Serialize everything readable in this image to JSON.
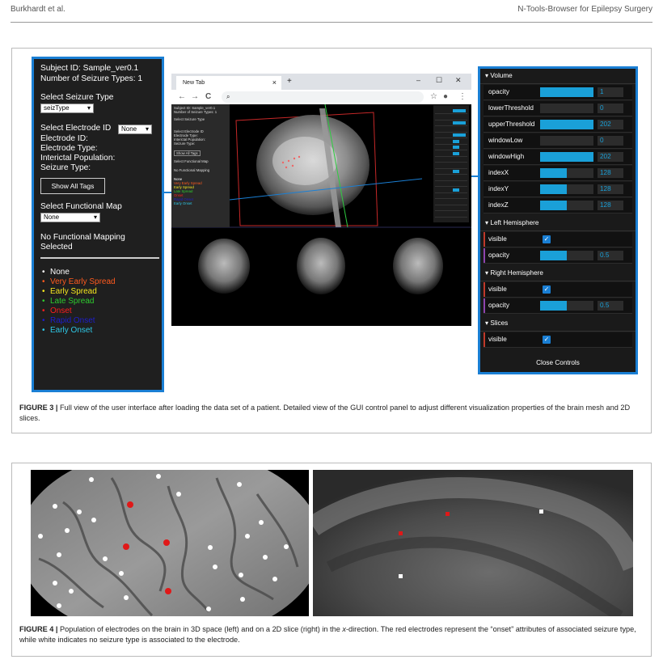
{
  "header": {
    "left": "Burkhardt et al.",
    "right": "N-Tools-Browser for Epilepsy Surgery"
  },
  "figure3": {
    "caption_label": "FIGURE 3 |",
    "caption_text": " Full view of the user interface after loading the data set of a patient. Detailed view of the GUI control panel to adjust different visualization properties of the brain mesh and 2D slices.",
    "left_panel": {
      "subject_id": "Subject ID: Sample_ver0.1",
      "seizure_types": "Number of Seizure Types: 1",
      "select_seizure_label": "Select Seizure Type",
      "seizure_select_value": "seizType",
      "select_electrode_label": "Select Electrode ID",
      "electrode_select_value": "None",
      "electrode_id": "Electrode ID:",
      "electrode_type": "Electrode Type:",
      "interictal": "Interictal Population:",
      "seizure_type": "Seizure Type:",
      "show_all_tags": "Show All Tags",
      "select_functional_label": "Select Functional Map",
      "functional_select_value": "None",
      "no_mapping_1": "No Functional Mapping",
      "no_mapping_2": "Selected",
      "legend": [
        {
          "label": "None",
          "color": "#ffffff"
        },
        {
          "label": "Very Early Spread",
          "color": "#ff5a1e"
        },
        {
          "label": "Early Spread",
          "color": "#f5e61e"
        },
        {
          "label": "Late Spread",
          "color": "#2ecc2e"
        },
        {
          "label": "Onset",
          "color": "#ff1e1e"
        },
        {
          "label": "Rapid Onset",
          "color": "#1e1ecc"
        },
        {
          "label": "Early Onset",
          "color": "#2ec8e6"
        }
      ]
    },
    "browser": {
      "tab_title": "New Tab",
      "tab_close": "×",
      "new_tab": "+",
      "minimize": "–",
      "maximize": "☐",
      "close": "✕",
      "back": "←",
      "forward": "→",
      "reload": "C",
      "search_glyph": "⌕",
      "star": "☆",
      "account": "●",
      "menu": "⋮"
    },
    "right_panel": {
      "volume_header": "Volume",
      "volume_rows": [
        {
          "label": "opacity",
          "value": "1",
          "fill": 1.0
        },
        {
          "label": "lowerThreshold",
          "value": "0",
          "fill": 0.0
        },
        {
          "label": "upperThreshold",
          "value": "202",
          "fill": 1.0
        },
        {
          "label": "windowLow",
          "value": "0",
          "fill": 0.0
        },
        {
          "label": "windowHigh",
          "value": "202",
          "fill": 1.0
        },
        {
          "label": "indexX",
          "value": "128",
          "fill": 0.5
        },
        {
          "label": "indexY",
          "value": "128",
          "fill": 0.5
        },
        {
          "label": "indexZ",
          "value": "128",
          "fill": 0.5
        }
      ],
      "left_hemisphere_header": "Left Hemisphere",
      "left_visible_label": "visible",
      "left_opacity_label": "opacity",
      "left_opacity_value": "0.5",
      "right_hemisphere_header": "Right Hemisphere",
      "right_visible_label": "visible",
      "right_opacity_label": "opacity",
      "right_opacity_value": "0.5",
      "slices_header": "Slices",
      "slices_visible_label": "visible",
      "close_controls": "Close Controls"
    }
  },
  "figure4": {
    "caption_label": "FIGURE 4 |",
    "caption_text_1": " Population of electrodes on the brain in 3D space (left) and on a 2D slice (right) in the ",
    "caption_italic": "x",
    "caption_text_2": "-direction. The red electrodes represent the “onset” attributes of associated seizure type, while white indicates no seizure type is associated to the electrode."
  }
}
